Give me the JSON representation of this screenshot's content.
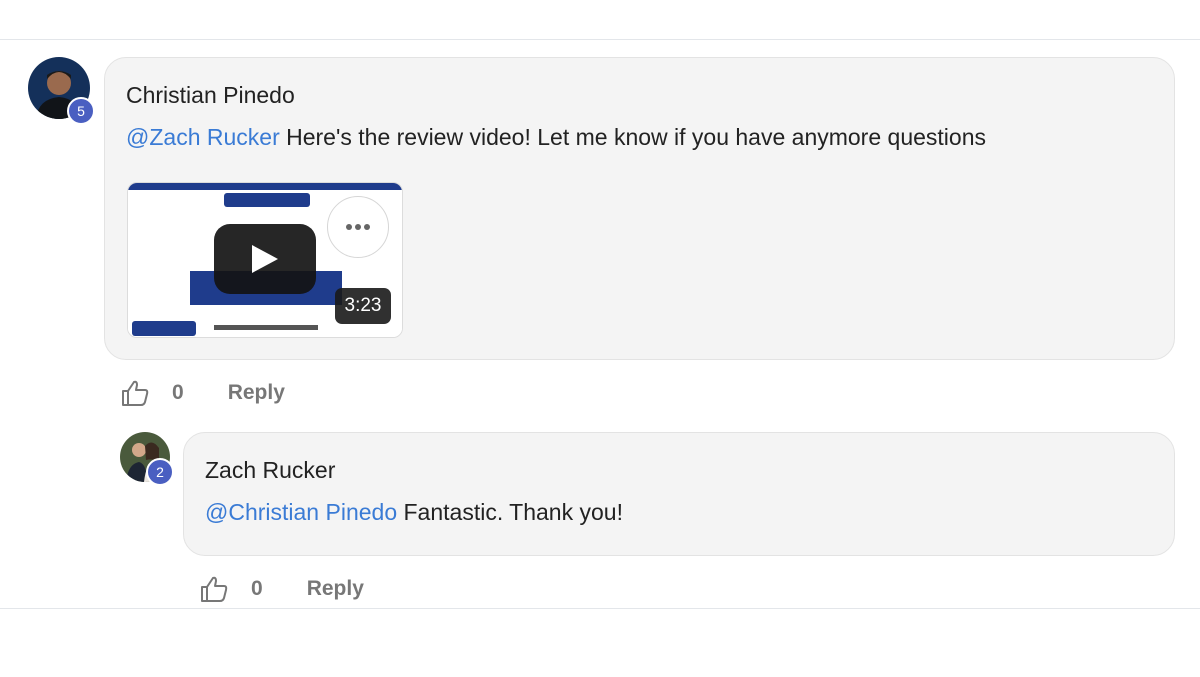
{
  "comment": {
    "author": "Christian Pinedo",
    "level": "5",
    "mention": "@Zach Rucker",
    "text": " Here's the review video! Let me know if you have anymore questions",
    "video": {
      "duration": "3:23",
      "more_icon": "more-dots-icon",
      "play_icon": "play-icon"
    },
    "likes": "0",
    "reply_label": "Reply"
  },
  "reply": {
    "author": "Zach Rucker",
    "level": "2",
    "mention": "@Christian Pinedo",
    "text": " Fantastic. Thank you!",
    "likes": "0",
    "reply_label": "Reply"
  },
  "colors": {
    "mention": "#3a7bd5",
    "badge": "#4a5fc1",
    "bubble": "#f4f4f4"
  }
}
